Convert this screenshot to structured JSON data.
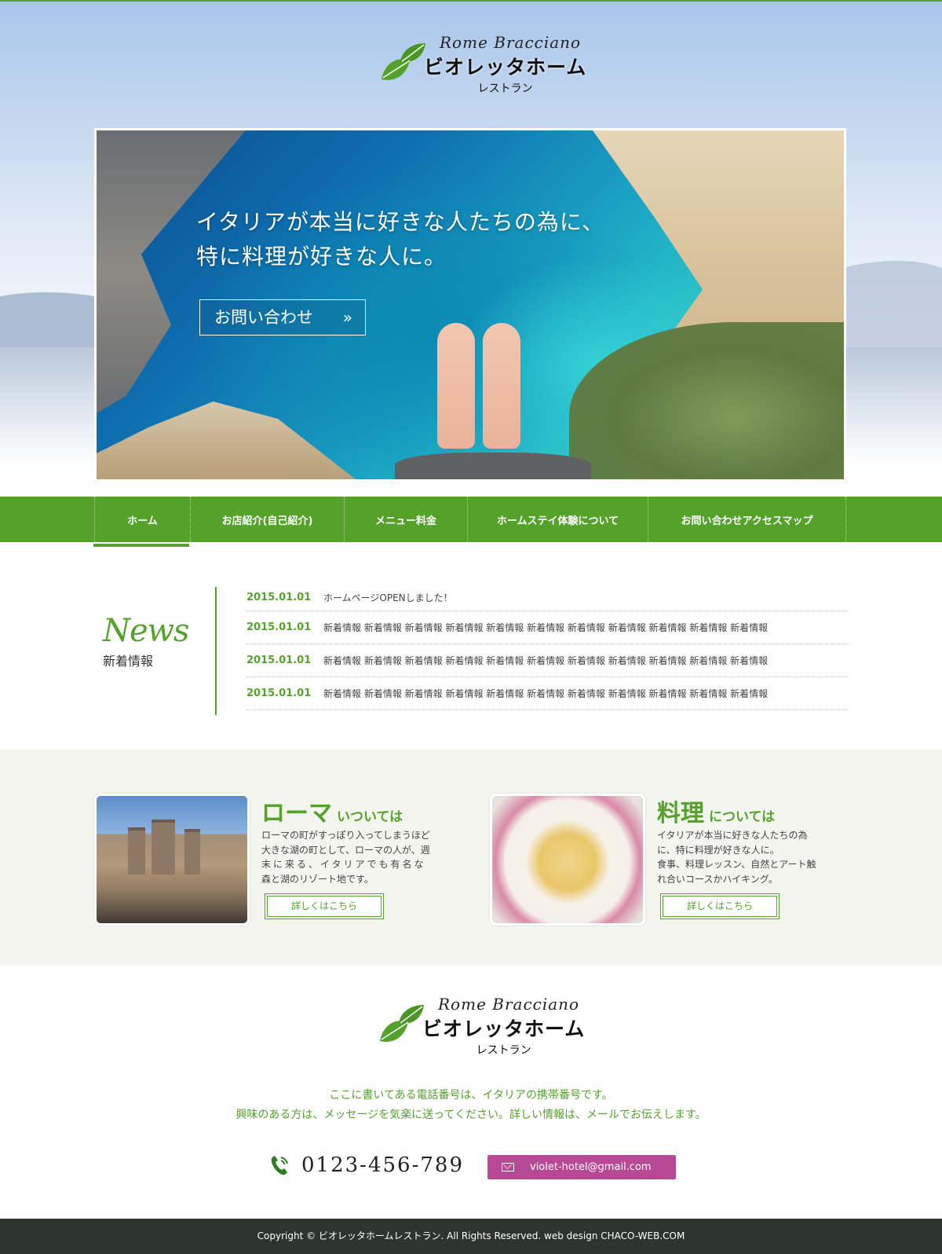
{
  "brand": {
    "subtitle": "Rome Bracciano",
    "name": "ビオレッタホーム",
    "tagline": "レストラン"
  },
  "hero": {
    "heading_line1": "イタリアが本当に好きな人たちの為に、",
    "heading_line2": "特に料理が好きな人に。",
    "button_label": "お問い合わせ",
    "button_arrow": "»"
  },
  "nav": {
    "items": [
      {
        "label": "ホーム",
        "active": true
      },
      {
        "label": "お店紹介(自己紹介)"
      },
      {
        "label": "メニュー料金"
      },
      {
        "label": "ホームステイ体験について"
      },
      {
        "label": "お問い合わせアクセスマップ"
      }
    ]
  },
  "news": {
    "title_en": "News",
    "title_ja": "新着情報",
    "items": [
      {
        "date": "2015.01.01",
        "text": "ホームページOPENしました！"
      },
      {
        "date": "2015.01.01",
        "text": "新着情報 新着情報 新着情報 新着情報 新着情報 新着情報 新着情報 新着情報 新着情報 新着情報 新着情報"
      },
      {
        "date": "2015.01.01",
        "text": "新着情報 新着情報 新着情報 新着情報 新着情報 新着情報 新着情報 新着情報 新着情報 新着情報 新着情報"
      },
      {
        "date": "2015.01.01",
        "text": "新着情報 新着情報 新着情報 新着情報 新着情報 新着情報 新着情報 新着情報 新着情報 新着情報 新着情報"
      }
    ]
  },
  "features": [
    {
      "title_big": "ローマ",
      "title_small": "いついては",
      "desc_lines": [
        "ローマの町がすっぽり入ってしまうほど",
        "大きな湖の町として、ローマの人が、週",
        "末に来る、イタリアでも有名な",
        "森と湖のリゾート地です。"
      ],
      "button_label": "詳しくはこちら"
    },
    {
      "title_big": "料理",
      "title_small": "については",
      "desc_lines": [
        "イタリアが本当に好きな人たちの為",
        "に、特に料理が好きな人に。",
        "食事、料理レッスン、自然とアート触",
        "れ合いコースかハイキング。"
      ],
      "button_label": "詳しくはこちら"
    }
  ],
  "footer": {
    "message_line1": "ここに書いてある電話番号は、イタリアの携帯番号です。",
    "message_line2": "興味のある方は、メッセージを気楽に送ってください。詳しい情報は、メールでお伝えします。",
    "phone": "0123-456-789",
    "email": "violet-hotel@gmail.com",
    "copyright": "Copyright © ビオレッタホームレストラン. All Rights Reserved. web design CHACO-WEB.COM"
  },
  "colors": {
    "accent_green": "#55a22b",
    "email_button": "#b84a95",
    "copyright_bar": "#2d362e",
    "features_bg": "#f3f5ee"
  },
  "icons": {
    "logo": "green-leaves-icon",
    "phone": "phone-icon",
    "email": "mail-icon",
    "arrow": "double-chevron-right-icon"
  }
}
